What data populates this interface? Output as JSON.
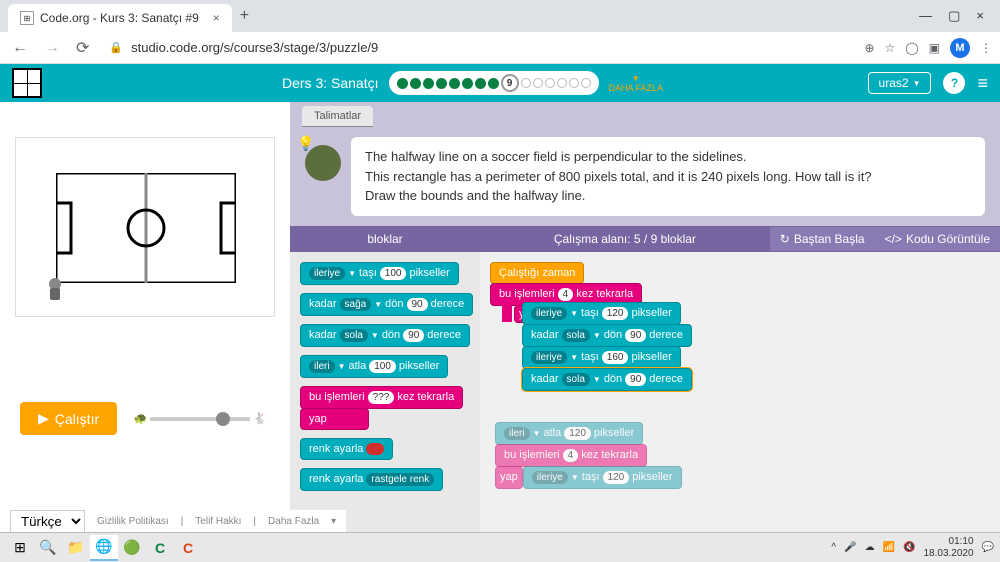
{
  "browser": {
    "tab_title": "Code.org - Kurs 3: Sanatçı #9",
    "url": "studio.code.org/s/course3/stage/3/puzzle/9",
    "user_initial": "M"
  },
  "header": {
    "lesson": "Ders 3: Sanatçı",
    "current_level": "9",
    "more": "DAHA FAZLA",
    "user": "uras2",
    "help": "?"
  },
  "instructions": {
    "tab": "Talimatlar",
    "line1": "The halfway line on a soccer field is perpendicular to the sidelines.",
    "line2": "This rectangle has a perimeter of 800 pixels total, and it is 240 pixels long. How tall is it?",
    "line3": "Draw the bounds and the halfway line."
  },
  "workspace_header": {
    "blocks": "bloklar",
    "area": "Çalışma alanı: 5 / 9 bloklar",
    "restart": "Baştan Başla",
    "show_code": "Kodu Görüntüle"
  },
  "toolbox": {
    "b1": {
      "p1": "ileriye",
      "p2": "taşı",
      "v": "100",
      "p3": "pikseller"
    },
    "b2": {
      "p1": "kadar",
      "p2": "sağa",
      "p3": "dön",
      "v": "90",
      "p4": "derece"
    },
    "b3": {
      "p1": "kadar",
      "p2": "sola",
      "p3": "dön",
      "v": "90",
      "p4": "derece"
    },
    "b4": {
      "p1": "ileri",
      "p2": "atla",
      "v": "100",
      "p3": "pikseller"
    },
    "b5": {
      "p1": "bu işlemleri",
      "v": "???",
      "p2": "kez tekrarla",
      "p3": "yap"
    },
    "b6": {
      "p1": "renk ayarla"
    },
    "b7": {
      "p1": "renk ayarla",
      "p2": "rastgele renk"
    }
  },
  "program": {
    "start": "Çalıştığı zaman",
    "loop": {
      "p1": "bu işlemleri",
      "v": "4",
      "p2": "kez tekrarla",
      "p3": "yap"
    },
    "s1": {
      "p1": "ileriye",
      "p2": "taşı",
      "v": "120",
      "p3": "pikseller"
    },
    "s2": {
      "p1": "kadar",
      "p2": "sola",
      "p3": "dön",
      "v": "90",
      "p4": "derece"
    },
    "s3": {
      "p1": "ileriye",
      "p2": "taşı",
      "v": "160",
      "p3": "pikseller"
    },
    "s4": {
      "p1": "kadar",
      "p2": "sola",
      "p3": "dön",
      "v": "90",
      "p4": "derece"
    }
  },
  "ghost": {
    "g1": {
      "p1": "ileri",
      "p2": "atla",
      "v": "120",
      "p3": "pikseller"
    },
    "g2": {
      "p1": "bu işlemleri",
      "v": "4",
      "p2": "kez tekrarla",
      "p3": "yap"
    },
    "g3": {
      "p1": "ileriye",
      "p2": "taşı",
      "v": "120",
      "p3": "pikseller"
    }
  },
  "run_btn": "Çalıştır",
  "footer": {
    "lang": "Türkçe",
    "privacy": "Gizlilik Politikası",
    "copyright": "Telif Hakkı",
    "more": "Daha Fazla"
  },
  "taskbar": {
    "time": "01:10",
    "date": "18.03.2020"
  }
}
